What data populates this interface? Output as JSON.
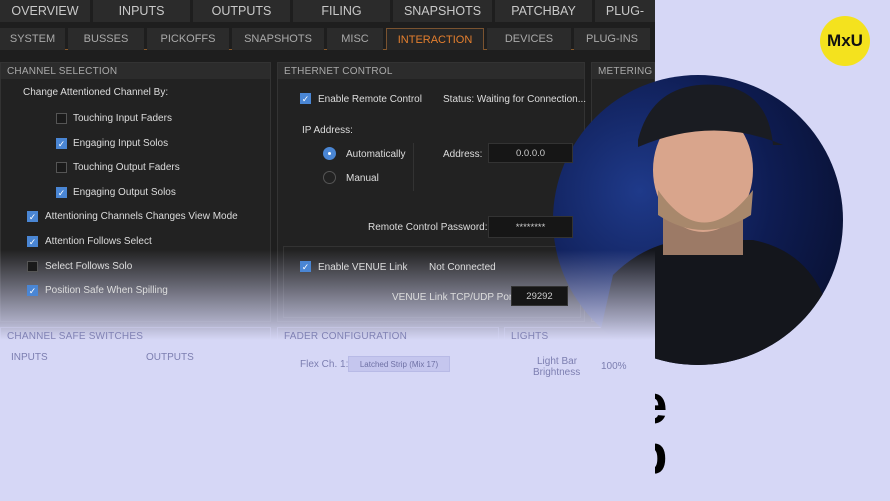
{
  "top_tabs": [
    "OVERVIEW",
    "INPUTS",
    "OUTPUTS",
    "FILING",
    "SNAPSHOTS",
    "PATCHBAY",
    "PLUG-"
  ],
  "sub_tabs": [
    "SYSTEM",
    "BUSSES",
    "PICKOFFS",
    "SNAPSHOTS",
    "MISC",
    "INTERACTION",
    "DEVICES",
    "PLUG-INS"
  ],
  "active_sub_tab": "INTERACTION",
  "channel_selection": {
    "title": "CHANNEL SELECTION",
    "label": "Change Attentioned Channel By:",
    "options": [
      {
        "label": "Touching Input Faders",
        "checked": false
      },
      {
        "label": "Engaging Input Solos",
        "checked": true
      },
      {
        "label": "Touching Output Faders",
        "checked": false
      },
      {
        "label": "Engaging Output Solos",
        "checked": true
      }
    ],
    "extra": [
      {
        "label": "Attentioning Channels Changes View Mode",
        "checked": true
      },
      {
        "label": "Attention Follows Select",
        "checked": true
      },
      {
        "label": "Select Follows Solo",
        "checked": false
      },
      {
        "label": "Position Safe When Spilling",
        "checked": true
      }
    ]
  },
  "ethernet": {
    "title": "ETHERNET CONTROL",
    "enable_remote": "Enable Remote Control",
    "status": "Status:  Waiting for Connection...",
    "ip_label": "IP Address:",
    "auto": "Automatically",
    "manual": "Manual",
    "address_label": "Address:",
    "address": "0.0.0.0",
    "password_label": "Remote Control Password:",
    "password": "********",
    "venue_link": "Enable VENUE Link",
    "venue_status": "Not Connected",
    "port_label": "VENUE Link TCP/UDP Port:",
    "port": "29292"
  },
  "metering": {
    "title": "METERING"
  },
  "safe": {
    "title": "CHANNEL SAFE SWITCHES",
    "inputs": "INPUTS",
    "outputs": "OUTPUTS"
  },
  "fader": {
    "title": "FADER CONFIGURATION",
    "flex_label": "Flex Ch. 1:",
    "flex_value": "Latched Strip (Mix 17)"
  },
  "lights": {
    "title": "LIGHTS",
    "light_bar": "Light Bar",
    "brightness": "Brightness",
    "value": "100%"
  },
  "headline": {
    "line1": "Console Preference",
    "line2": "Setup"
  },
  "logo": "MxU",
  "colors": {
    "accent": "#e57f2e",
    "check": "#4a86d4",
    "background": "#d6d7f6",
    "logo": "#f4e21e"
  }
}
